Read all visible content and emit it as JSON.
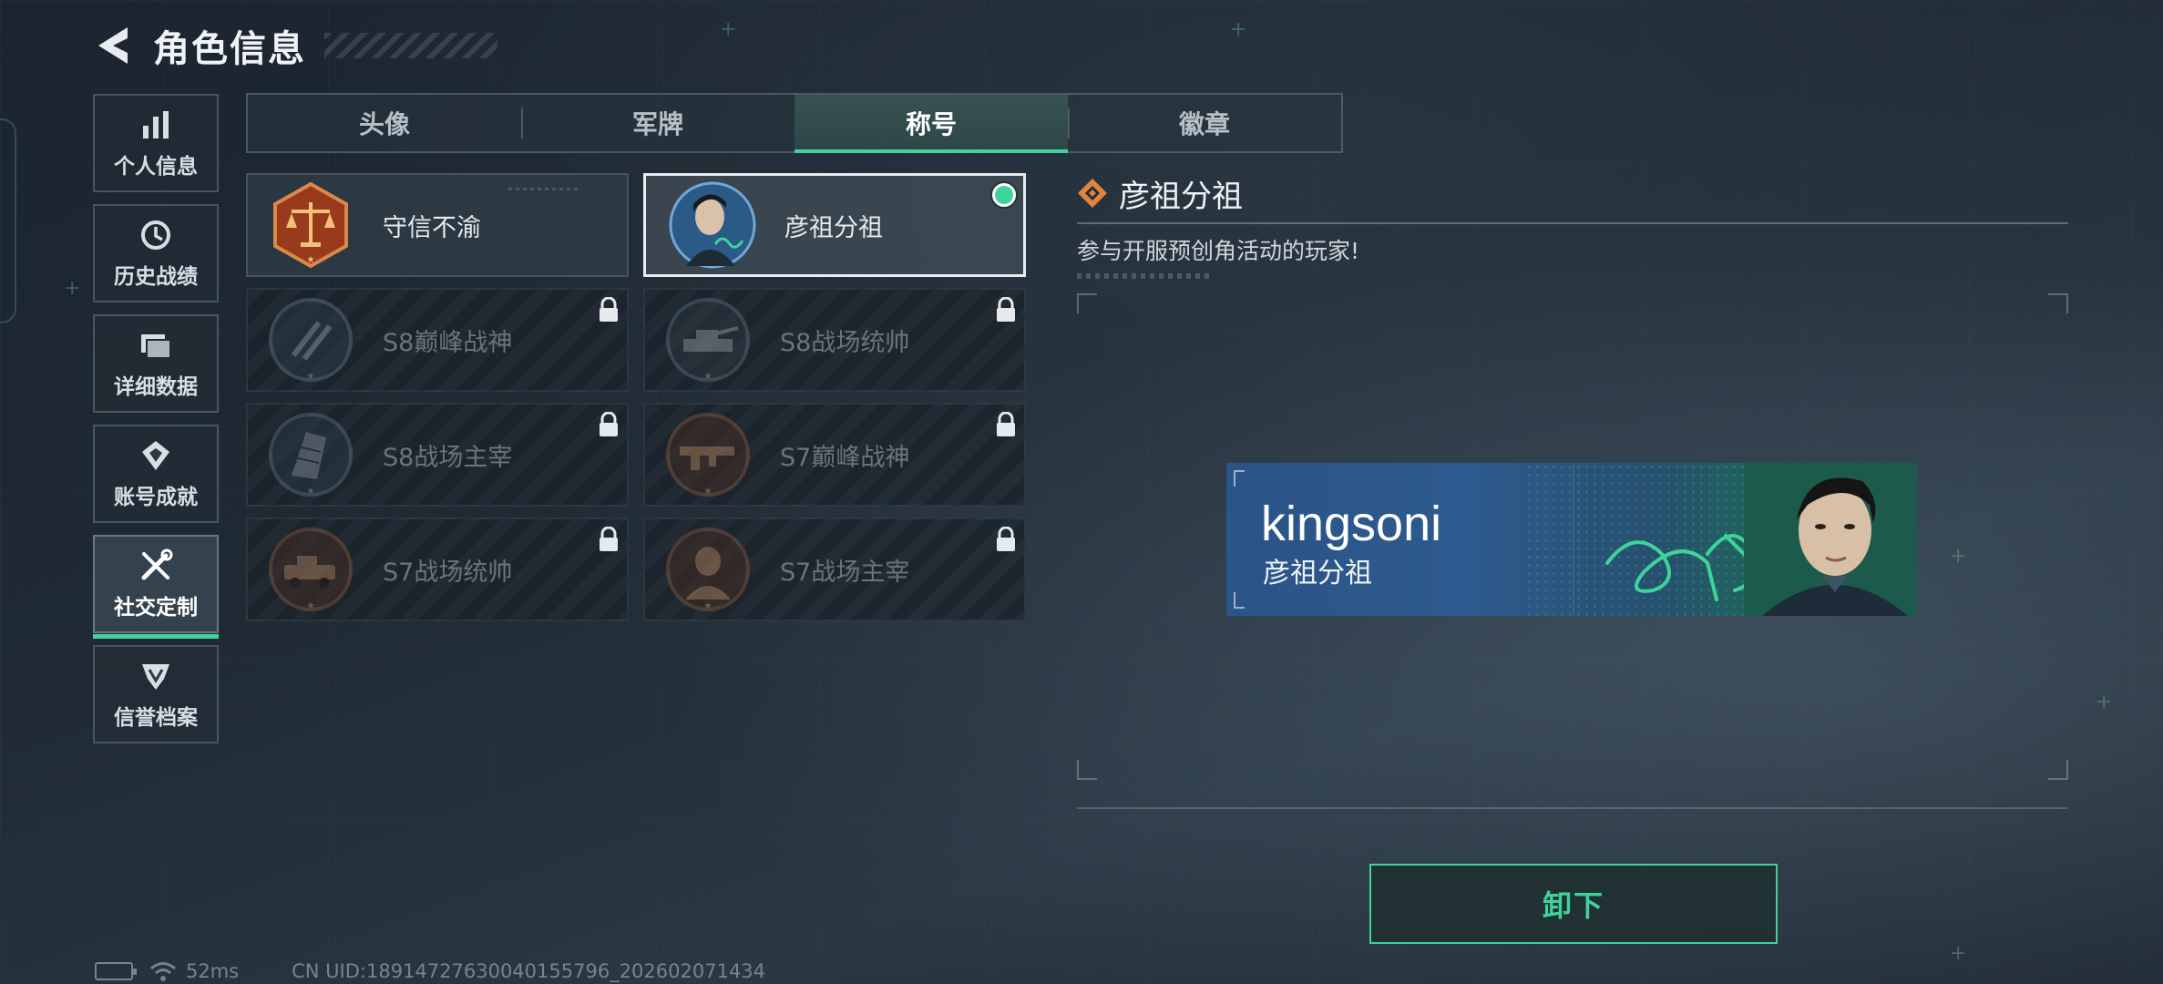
{
  "header": {
    "title": "角色信息"
  },
  "sidebar": {
    "items": [
      {
        "label": "个人信息",
        "icon": "bar-chart-icon",
        "active": false
      },
      {
        "label": "历史战绩",
        "icon": "history-clock-icon",
        "active": false
      },
      {
        "label": "详细数据",
        "icon": "folder-icon",
        "active": false
      },
      {
        "label": "账号成就",
        "icon": "achievement-medal-icon",
        "active": false
      },
      {
        "label": "社交定制",
        "icon": "wrench-screwdriver-icon",
        "active": true
      },
      {
        "label": "信誉档案",
        "icon": "credit-shield-icon",
        "active": false
      }
    ]
  },
  "tabs": [
    {
      "label": "头像",
      "active": false
    },
    {
      "label": "军牌",
      "active": false
    },
    {
      "label": "称号",
      "active": true
    },
    {
      "label": "徽章",
      "active": false
    }
  ],
  "titles": [
    {
      "label": "守信不渝",
      "badge": "scales-badge-icon",
      "locked": false,
      "selected": false
    },
    {
      "label": "彦祖分祖",
      "badge": "portrait-badge-icon",
      "locked": false,
      "selected": true,
      "equipped": true
    },
    {
      "label": "S8巅峰战神",
      "badge": "stripe-badge-icon",
      "locked": true
    },
    {
      "label": "S8战场统帅",
      "badge": "tank-badge-icon",
      "locked": true
    },
    {
      "label": "S8战场主宰",
      "badge": "building-badge-icon",
      "locked": true
    },
    {
      "label": "S7巅峰战神",
      "badge": "rifle-badge-icon",
      "locked": true
    },
    {
      "label": "S7战场统帅",
      "badge": "vehicle-badge-icon",
      "locked": true
    },
    {
      "label": "S7战场主宰",
      "badge": "soldier-badge-icon",
      "locked": true
    }
  ],
  "detail": {
    "title": "彦祖分祖",
    "description": "参与开服预创角活动的玩家!"
  },
  "nameplate": {
    "username": "kingsoni",
    "title": "彦祖分祖"
  },
  "actions": {
    "unequip_label": "卸下"
  },
  "status": {
    "ping": "52ms",
    "uid": "CN UID:18914727630040155796_202602071434"
  },
  "colors": {
    "accent": "#3ed39a",
    "background": "#1f2a34",
    "nameplate_blue": "#2b5488",
    "detail_icon": "#e0843c"
  }
}
